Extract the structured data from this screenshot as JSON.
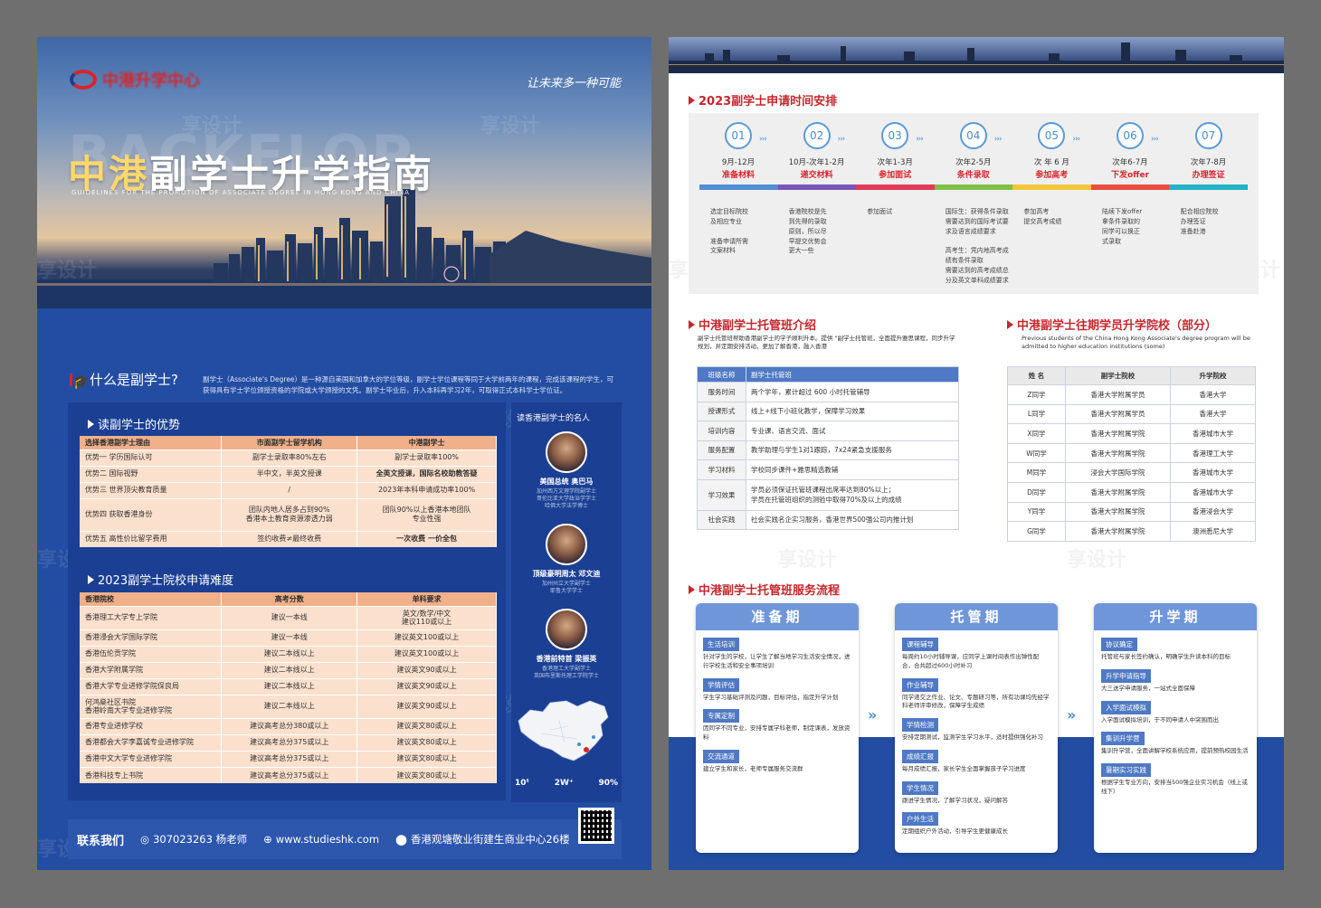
{
  "left": {
    "logo_text": "中港升学中心",
    "slogan": "让未来多一种可能",
    "bg_word": "BACKFLOP",
    "title_hl": "中港",
    "title_rest": "副学士升学指南",
    "subtitle": "GUIDELINES FOR THE PROMOTION OF ASSOCIATE DEGREE IN HONG KONG AND CHINA",
    "what_title": "什么是副学士?",
    "what_text": "副学士（Associate's Degree）是一种源自美国和加拿大的学位等级，副学士学位课程等同于大学前两年的课程，完成该课程的学生，可获得具有学士学位颁授资格的学院或大学颁授的文凭。副学士毕业后，升入本科再学习2年，可取得正式本科学士学位证。",
    "adv_title": "读副学士的优势",
    "adv_headers": [
      "选择香港副学士理由",
      "市面副学士留学机构",
      "中港副学士"
    ],
    "adv_rows": [
      [
        "优势一  学历国际认可",
        "副学士录取率80%左右",
        "副学士录取率100%"
      ],
      [
        "优势二  国际视野",
        "半中文，半英文授课",
        "全英文授课，国际名校助教答疑"
      ],
      [
        "优势三  世界顶尖教育质量",
        "/",
        "2023年本科申请成功率100%"
      ],
      [
        "优势四  获取香港身份",
        "团队内地人居多占到90%\n香港本土教育资源渗透力弱",
        "团队90%以上香港本地团队\n专业性强"
      ],
      [
        "优势五  高性价比留学费用",
        "签约收费≠最终收费",
        "一次收费  一价全包"
      ]
    ],
    "diff_title": "2023副学士院校申请难度",
    "diff_headers": [
      "香港院校",
      "高考分数",
      "单科要求"
    ],
    "diff_rows": [
      [
        "香港理工大学专上学院",
        "建议一本线",
        "英文/数学/中文\n建议110或以上"
      ],
      [
        "香港浸会大学国际学院",
        "建议一本线",
        "建议英文100或以上"
      ],
      [
        "香港伍伦贡学院",
        "建议二本线以上",
        "建议英文100或以上"
      ],
      [
        "香港大学附属学院",
        "建议二本线以上",
        "建议英文90或以上"
      ],
      [
        "香港大学专业进修学院保良局",
        "建议二本线以上",
        "建议英文90或以上"
      ],
      [
        "何鸿燊社区书院\n香港岭南大学专业进修学院",
        "建议二本线以上",
        "建议英文90或以上"
      ],
      [
        "香港专业进修学校",
        "建议高考总分380或以上",
        "建议英文80或以上"
      ],
      [
        "香港都会大学李嘉诚专业进修学院",
        "建议高考总分375或以上",
        "建议英文80或以上"
      ],
      [
        "香港中文大学专业进修学院",
        "建议高考总分375或以上",
        "建议英文80或以上"
      ],
      [
        "香港科技专上书院",
        "建议高考总分375或以上",
        "建议英文80或以上"
      ]
    ],
    "famous_title": "读香港副学士的名人",
    "people": [
      {
        "name": "美国总统 奥巴马",
        "desc": "加州西方文理学院副学士\n哥伦比亚大学政治学学士\n哈佛大学法学博士"
      },
      {
        "name": "顶级豪明周太 邓文迪",
        "desc": "加州州立大学副学士\n耶鲁大学学士"
      },
      {
        "name": "香港前特首 梁振英",
        "desc": "香港理工大学副学士\n英国布里斯托理工学院学士"
      }
    ],
    "stats": [
      "10ᵗ",
      "2W⁺",
      "90%"
    ],
    "contact_label": "联系我们",
    "contact_qq": "307023263 杨老师",
    "contact_web": "www.studieshk.com",
    "contact_addr": "香港观塘敬业街建生商业中心26楼"
  },
  "right": {
    "timeline_title": "2023副学士申请时间安排",
    "steps": [
      {
        "num": "01",
        "date": "9月-12月",
        "name": "准备材料",
        "desc": "选定目标院校\n及相应专业\n\n准备申请所需\n文案材料"
      },
      {
        "num": "02",
        "date": "10月-次年1-2月",
        "name": "递交材料",
        "desc": "香港院校是先\n到先得的录取\n原则，所以尽\n早提交优势会\n更大一些"
      },
      {
        "num": "03",
        "date": "次年1-3月",
        "name": "参加面试",
        "desc": "参加面试"
      },
      {
        "num": "04",
        "date": "次年2-5月",
        "name": "条件录取",
        "desc": "国际生：获得条件录取\n需要达到的国际考试要\n求及语言成绩要求\n\n高考生：凭内地高考成\n绩有条件录取\n需要达到的高考成绩总\n分及英文单科成绩要求"
      },
      {
        "num": "05",
        "date": "次 年 6 月",
        "name": "参加高考",
        "desc": "参加高考\n提交高考成绩"
      },
      {
        "num": "06",
        "date": "次年6-7月",
        "name": "下发offer",
        "desc": "陆续下发offer\n拿条件录取的\n同学可以换正\n式录取"
      },
      {
        "num": "07",
        "date": "次年7-8月",
        "name": "办理签证",
        "desc": "配合相应院校\n办理签证\n准备赴港"
      }
    ],
    "step_colors": [
      "#4f8fd4",
      "#7a56b8",
      "#e23b5a",
      "#7cc146",
      "#f3c63a",
      "#e94e3f",
      "#23b3c4"
    ],
    "tg_title": "中港副学士托管班介绍",
    "tg_sub": "副学士托管班帮助香港副学士的学子顺利升本。提供 \"副学士托管班，全面提升雅思课程，同步升学规划，并定期安排活动，更加了解香港，融入香港",
    "tg_rows": [
      [
        "班级名称",
        "副学士托管班"
      ],
      [
        "服务时间",
        "两个学年，累计超过 600 小时托管辅导"
      ],
      [
        "授课形式",
        "线上+线下小班化教学，保障学习效果"
      ],
      [
        "培训内容",
        "专业课、语言交流、面试"
      ],
      [
        "服务配置",
        "教学助理与学生1对1跟踪，7x24紧急支援服务"
      ],
      [
        "学习材料",
        "学校同步课件+雅思精选教辅"
      ],
      [
        "学习效果",
        "学员必须保证托管班课程出席率达到80%以上；\n学员在托管班组织的测验中取得70%及以上的成绩"
      ],
      [
        "社会实践",
        "社会实践名企实习服务，香港世界500强公司内推计划"
      ]
    ],
    "past_title": "中港副学士往期学员升学院校（部分）",
    "past_sub": "Previous students of the China Hong Kong Associate's degree program will be admitted to higher education institutions (some)",
    "past_headers": [
      "姓 名",
      "副学士院校",
      "升学院校"
    ],
    "past_rows": [
      [
        "Z同学",
        "香港大学附属学员",
        "香港大学"
      ],
      [
        "L同学",
        "香港大学附属学员",
        "香港大学"
      ],
      [
        "X同学",
        "香港大学附属学院",
        "香港城市大学"
      ],
      [
        "W同学",
        "香港大学附属学院",
        "香港理工大学"
      ],
      [
        "M同学",
        "浸会大学国际学院",
        "香港城市大学"
      ],
      [
        "D同学",
        "香港大学附属学院",
        "香港城市大学"
      ],
      [
        "Y同学",
        "香港大学附属学院",
        "香港浸会大学"
      ],
      [
        "G同学",
        "香港大学附属学院",
        "澳洲悉尼大学"
      ]
    ],
    "flow_title": "中港副学士托管班服务流程",
    "cards": [
      {
        "title": "准备期",
        "items": [
          {
            "t": "生活培训",
            "d": "针对学生的学校，让学生了解当地学习生活安全情况，进行学校生活和安全事项培训"
          },
          {
            "t": "学情评估",
            "d": "学生学习基础评测及问题，目标评估，指定升学计划"
          },
          {
            "t": "专属定制",
            "d": "因同学不同专业，安排专属学科老师，制定课表，发放资料"
          },
          {
            "t": "交流通道",
            "d": "建立学生和家长，老师专属服务交流群"
          }
        ]
      },
      {
        "title": "托管期",
        "items": [
          {
            "t": "课程辅导",
            "d": "每周约10小时辅导课，应同学上课时间表作出弹性配合，合共超过600小时补习"
          },
          {
            "t": "作业辅导",
            "d": "同学递交之作业、论文、专题研习等，所有功课均先经学科老师评审修改，保障学生成绩"
          },
          {
            "t": "学情检测",
            "d": "安排定期测试，监测学生学习水平，适时提供强化补习"
          },
          {
            "t": "成绩汇报",
            "d": "每月成绩汇报，家长学生全面掌握孩子学习进度"
          },
          {
            "t": "学生情况",
            "d": "跟进学生情况，了解学习状况，疑问解答"
          },
          {
            "t": "户外生活",
            "d": "定期组织户外活动，引导学生更健康成长"
          }
        ]
      },
      {
        "title": "升学期",
        "items": [
          {
            "t": "协议确定",
            "d": "托管班与家长签约确认，明确学生升读本科的目标"
          },
          {
            "t": "升学申请指导",
            "d": "大三送学申请服务，一站式全面保障"
          },
          {
            "t": "入学面试模拟",
            "d": "入学面试模拟培训，于不同申请人中突围而出"
          },
          {
            "t": "集训升学营",
            "d": "集训升学营，全面讲解学校系统应用，提前预热校园生活"
          },
          {
            "t": "暑期实习实践",
            "d": "根据学生专业方向，安排当500强企业实习机会（线上或线下）"
          }
        ]
      }
    ]
  }
}
